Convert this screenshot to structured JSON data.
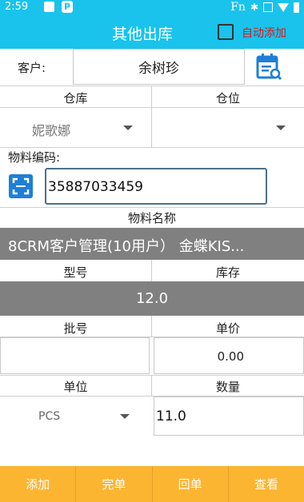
{
  "status": {
    "time": "2:59",
    "fn": "Fn"
  },
  "header": {
    "title": "其他出库",
    "auto_add_label": "自动添加",
    "auto_add_checked": false
  },
  "customer": {
    "label": "客户:",
    "value": "余树珍"
  },
  "warehouse": {
    "label": "仓库",
    "value": "妮歌娜"
  },
  "location": {
    "label": "仓位",
    "value": ""
  },
  "material_code": {
    "label": "物料编码:",
    "value": "35887033459"
  },
  "material_name": {
    "label": "物料名称",
    "value": "8CRM客户管理(10用户） 金蝶KIS..."
  },
  "model": {
    "label": "型号",
    "value": ""
  },
  "stock": {
    "label": "库存",
    "value": "12.0"
  },
  "batch": {
    "label": "批号",
    "value": ""
  },
  "price": {
    "label": "单价",
    "value": "0.00"
  },
  "unit": {
    "label": "单位",
    "value": "PCS"
  },
  "quantity": {
    "label": "数量",
    "value": "11.0"
  },
  "actions": {
    "add": "添加",
    "finish": "完单",
    "revert": "回单",
    "view": "查看"
  }
}
